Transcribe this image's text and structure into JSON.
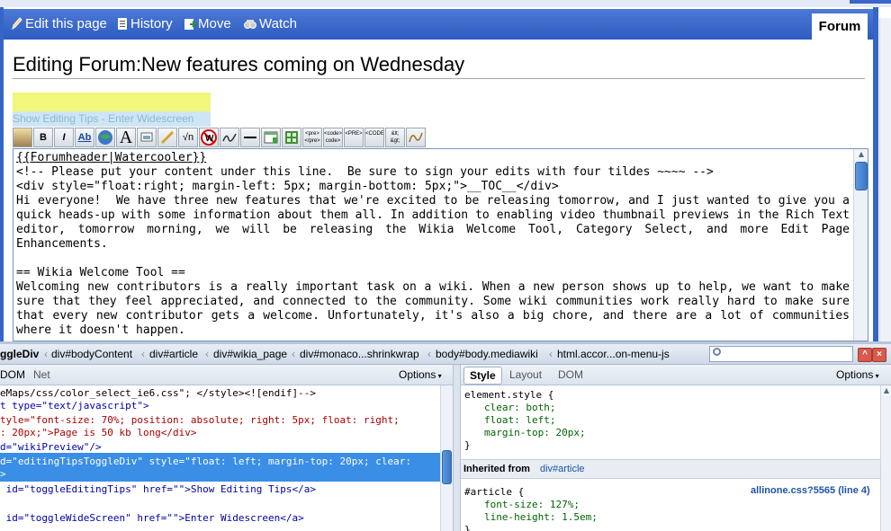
{
  "wiki": {
    "actions": [
      {
        "label": "Edit this page",
        "icon": "pencil-icon"
      },
      {
        "label": "History",
        "icon": "history-icon"
      },
      {
        "label": "Move",
        "icon": "move-icon"
      },
      {
        "label": "Watch",
        "icon": "watch-icon"
      }
    ],
    "forum_tab": "Forum",
    "title": "Editing Forum:New features coming on Wednesday",
    "tips_bar": "Show Editing Tips - Enter Widescreen",
    "toolbar_buttons": [
      {
        "label": "",
        "icon": "image-gallery-icon"
      },
      {
        "label": "B",
        "icon": "bold-icon"
      },
      {
        "label": "I",
        "icon": "italic-icon"
      },
      {
        "label": "Ab",
        "icon": "internal-link-icon"
      },
      {
        "label": "",
        "icon": "external-link-icon"
      },
      {
        "label": "A",
        "icon": "heading-icon"
      },
      {
        "label": "",
        "icon": "embedded-file-icon"
      },
      {
        "label": "",
        "icon": "media-link-icon"
      },
      {
        "label": "√n",
        "icon": "math-formula-icon"
      },
      {
        "label": "W",
        "icon": "nowiki-icon"
      },
      {
        "label": "",
        "icon": "signature-icon"
      },
      {
        "label": "",
        "icon": "horizontal-line-icon"
      },
      {
        "label": "",
        "icon": "insert-table-icon"
      },
      {
        "label": "",
        "icon": "gallery-icon"
      },
      {
        "label": "<pre> </pre>",
        "icon": "pre-icon"
      },
      {
        "label": "<code> code>",
        "icon": "code-icon"
      },
      {
        "label": "<PRE>",
        "icon": "pre-alt-icon"
      },
      {
        "label": "<CODE>",
        "icon": "code-alt-icon"
      },
      {
        "label": "&lt; &gt;",
        "icon": "entities-icon"
      },
      {
        "label": "",
        "icon": "signature-alt-icon"
      }
    ],
    "editor_lines": [
      "{{Forumheader|Watercooler}}",
      "<!-- Please put your content under this line.  Be sure to sign your edits with four tildes ~~~~ -->",
      "<div style=\"float:right; margin-left: 5px; margin-bottom: 5px;\">__TOC__</div>",
      "Hi everyone!  We have three new features that we're excited to be releasing tomorrow, and I just wanted to give you a quick heads-up with some information about them all. In addition to enabling video thumbnail previews in the Rich Text editor, tomorrow morning, we will be releasing the Wikia Welcome Tool, Category Select, and more Edit Page Enhancements.",
      "",
      "== Wikia Welcome Tool ==",
      "Welcoming new contributors is a really important task on a wiki. When a new person shows up to help, we want to make sure that they feel appreciated, and connected to the community. Some wiki communities work really hard to make sure that every new contributor gets a welcome. Unfortunately, it's also a big chore, and there are a lot of communities where it doesn't happen."
    ]
  },
  "firebug": {
    "breadcrumbs": [
      "ggleDiv",
      "div#bodyContent",
      "div#article",
      "div#wikia_page",
      "div#monaco...shrinkwrap",
      "body#body.mediawiki",
      "html.accor...on-menu-js"
    ],
    "left_tabs": [
      "DOM",
      "Net"
    ],
    "options_label": "Options",
    "html_lines": [
      "eMaps/css/color_select_ie6.css\"; </style><![endif]-->",
      "t type=\"text/javascript\">",
      "tyle=\"font-size: 70%; position: absolute; right: 5px; float: right;",
      ": 20px;\">Page is 50 kb long</div>",
      "d=\"wikiPreview\"/>",
      "d=\"editingTipsToggleDiv\" style=\"float: left; margin-top: 20px; clear:",
      ">",
      " id=\"toggleEditingTips\" href=\"\">Show Editing Tips</a>",
      " id=\"toggleWideScreen\" href=\"\">Enter Widescreen</a>"
    ],
    "right_tabs": [
      "Style",
      "Layout",
      "DOM"
    ],
    "css_element": {
      "selector": "element.style {",
      "props": [
        "clear: both;",
        "float: left;",
        "margin-top: 20px;"
      ],
      "close": "}"
    },
    "inherited_label": "Inherited from",
    "inherited_link": "div#article",
    "css_article": {
      "selector": "#article {",
      "source": "allinone.css?5565 (line 4)",
      "props": [
        "font-size: 127%;",
        "line-height: 1.5em;"
      ],
      "close": "}"
    }
  },
  "colors": {
    "wiki_bar": "#2d5bc0",
    "selection": "#3a8ee6",
    "tips_highlight": "#f0f77a"
  }
}
